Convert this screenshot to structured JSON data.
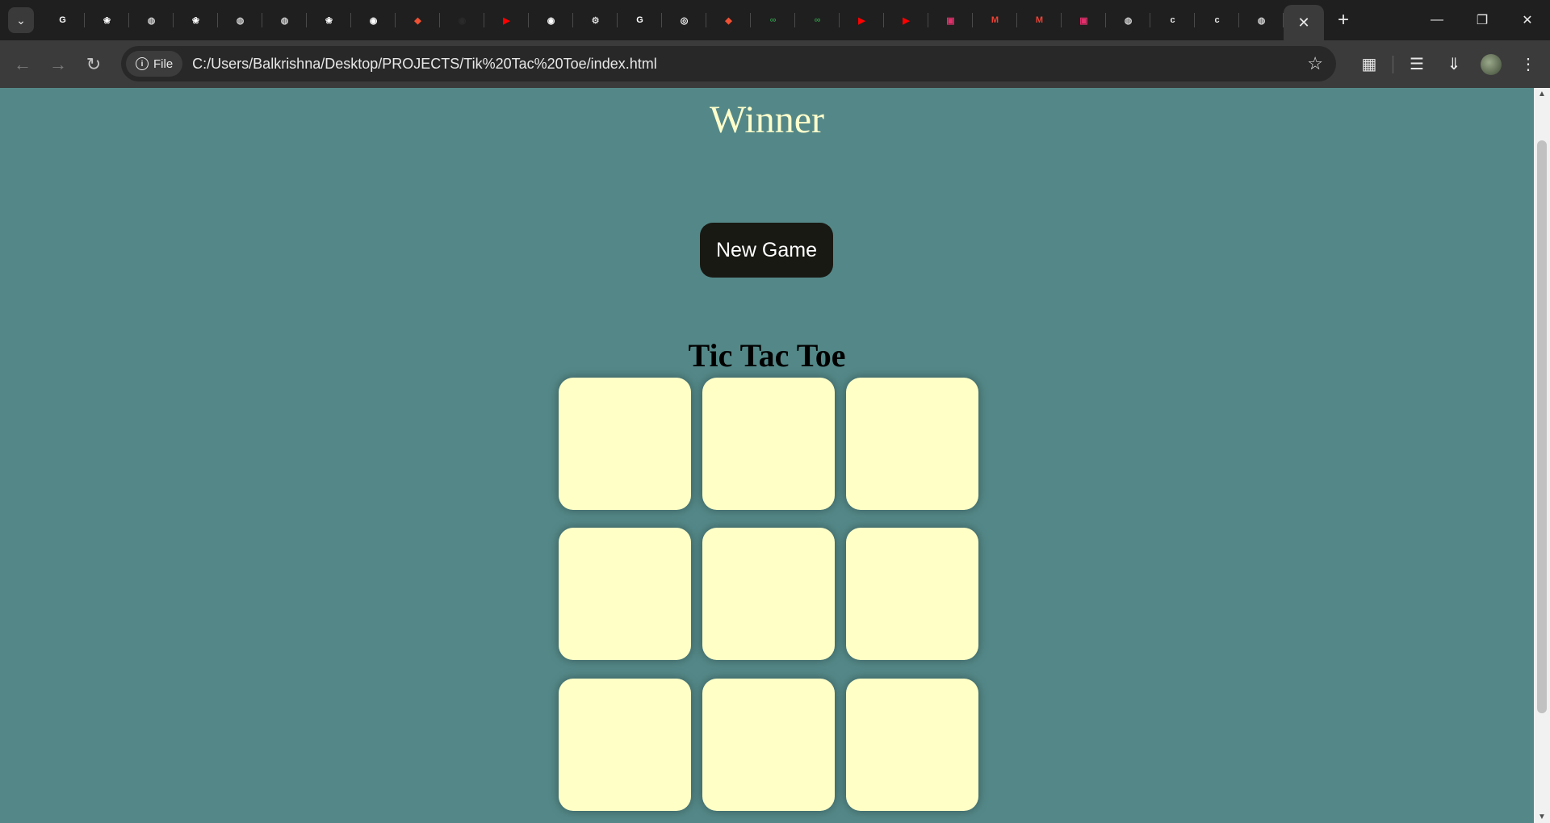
{
  "browser": {
    "url": "C:/Users/Balkrishna/Desktop/PROJECTS/Tik%20Tac%20Toe/index.html",
    "site_chip": "File",
    "tabs": [
      {
        "icon": "google-icon",
        "color": "#ffffff"
      },
      {
        "icon": "openai-icon",
        "color": "#ffffff"
      },
      {
        "icon": "globe-icon",
        "color": "#cfcfcf"
      },
      {
        "icon": "openai-icon",
        "color": "#ffffff"
      },
      {
        "icon": "globe-icon",
        "color": "#cfcfcf"
      },
      {
        "icon": "globe-icon",
        "color": "#cfcfcf"
      },
      {
        "icon": "openai-icon",
        "color": "#ffffff"
      },
      {
        "icon": "github-icon",
        "color": "#ffffff"
      },
      {
        "icon": "git-icon",
        "color": "#f05033"
      },
      {
        "icon": "github-icon",
        "color": "#2a2a2a"
      },
      {
        "icon": "youtube-icon",
        "color": "#ff0000"
      },
      {
        "icon": "github-icon",
        "color": "#ffffff"
      },
      {
        "icon": "settings-icon",
        "color": "#e0e0e0"
      },
      {
        "icon": "google-icon",
        "color": "#ffffff"
      },
      {
        "icon": "google-lens-icon",
        "color": "#ffffff"
      },
      {
        "icon": "git-icon",
        "color": "#f05033"
      },
      {
        "icon": "geeksforgeeks-icon",
        "color": "#2f8d46"
      },
      {
        "icon": "geeksforgeeks-icon",
        "color": "#2f8d46"
      },
      {
        "icon": "youtube-icon",
        "color": "#ff0000"
      },
      {
        "icon": "youtube-icon",
        "color": "#ff0000"
      },
      {
        "icon": "instagram-icon",
        "color": "#e1306c"
      },
      {
        "icon": "gmail-icon",
        "color": "#ea4335"
      },
      {
        "icon": "gmail-icon",
        "color": "#ea4335"
      },
      {
        "icon": "instagram-icon",
        "color": "#e1306c"
      },
      {
        "icon": "globe-icon",
        "color": "#cfcfcf"
      },
      {
        "icon": "c-icon",
        "color": "#e8e8e8"
      },
      {
        "icon": "c-icon",
        "color": "#e8e8e8"
      },
      {
        "icon": "globe-icon",
        "color": "#cfcfcf"
      }
    ]
  },
  "page": {
    "winner_text": "Winner",
    "new_game_label": "New Game",
    "title": "Tic Tac Toe",
    "cells": [
      "",
      "",
      "",
      "",
      "",
      "",
      "",
      "",
      ""
    ]
  },
  "colors": {
    "background": "#548888",
    "cell": "#ffffc6",
    "winner_text": "#ffffcc",
    "button": "#191913"
  }
}
